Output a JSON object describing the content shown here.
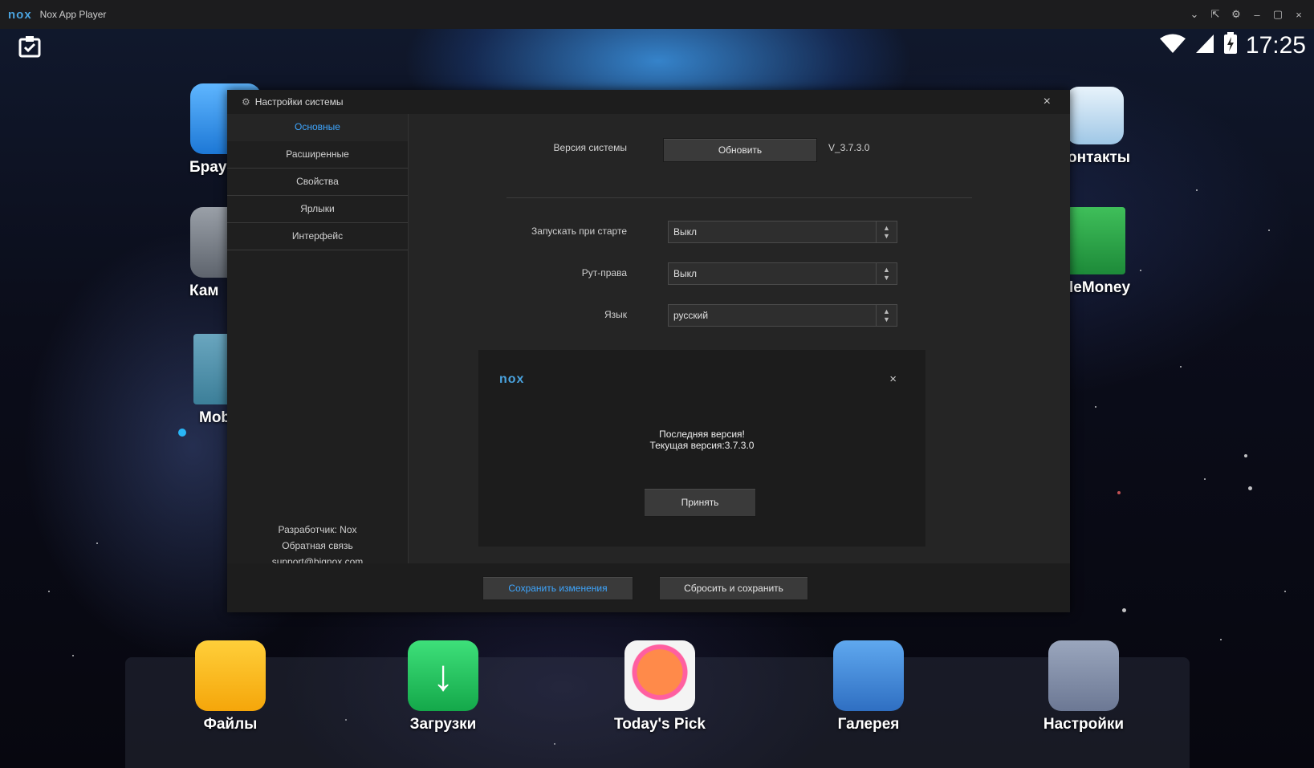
{
  "window": {
    "logo": "nox",
    "title": "Nox App Player",
    "controls": [
      "⌄",
      "⇱",
      "⚙",
      "–",
      "▢",
      "×"
    ]
  },
  "status_bar": {
    "clock": "17:25"
  },
  "desktop": {
    "left_apps": [
      "Брау",
      "Кам",
      "Mobi"
    ],
    "right_apps": [
      "онтакты",
      "leMoney"
    ],
    "dock": [
      "Файлы",
      "Загрузки",
      "Today's Pick",
      "Галерея",
      "Настройки"
    ]
  },
  "settings": {
    "title": "Настройки системы",
    "tabs": [
      "Основные",
      "Расширенные",
      "Свойства",
      "Ярлыки",
      "Интерфейс"
    ],
    "developer": "Разработчик: Nox",
    "feedback": "Обратная связь",
    "email": "support@bignox.com",
    "version_label": "Версия системы",
    "update_button": "Обновить",
    "version_value": "V_3.7.3.0",
    "autostart_label": "Запускать при старте",
    "autostart_value": "Выкл",
    "root_label": "Рут-права",
    "root_value": "Выкл",
    "language_label": "Язык",
    "language_value": "русский",
    "save_button": "Сохранить изменения",
    "reset_button": "Сбросить и сохранить",
    "colors": {
      "accent": "#3ea6ff",
      "panel": "#252525"
    }
  },
  "popup": {
    "logo": "nox",
    "line1": "Последняя версия!",
    "line2": "Текущая версия:3.7.3.0",
    "accept_button": "Принять"
  }
}
